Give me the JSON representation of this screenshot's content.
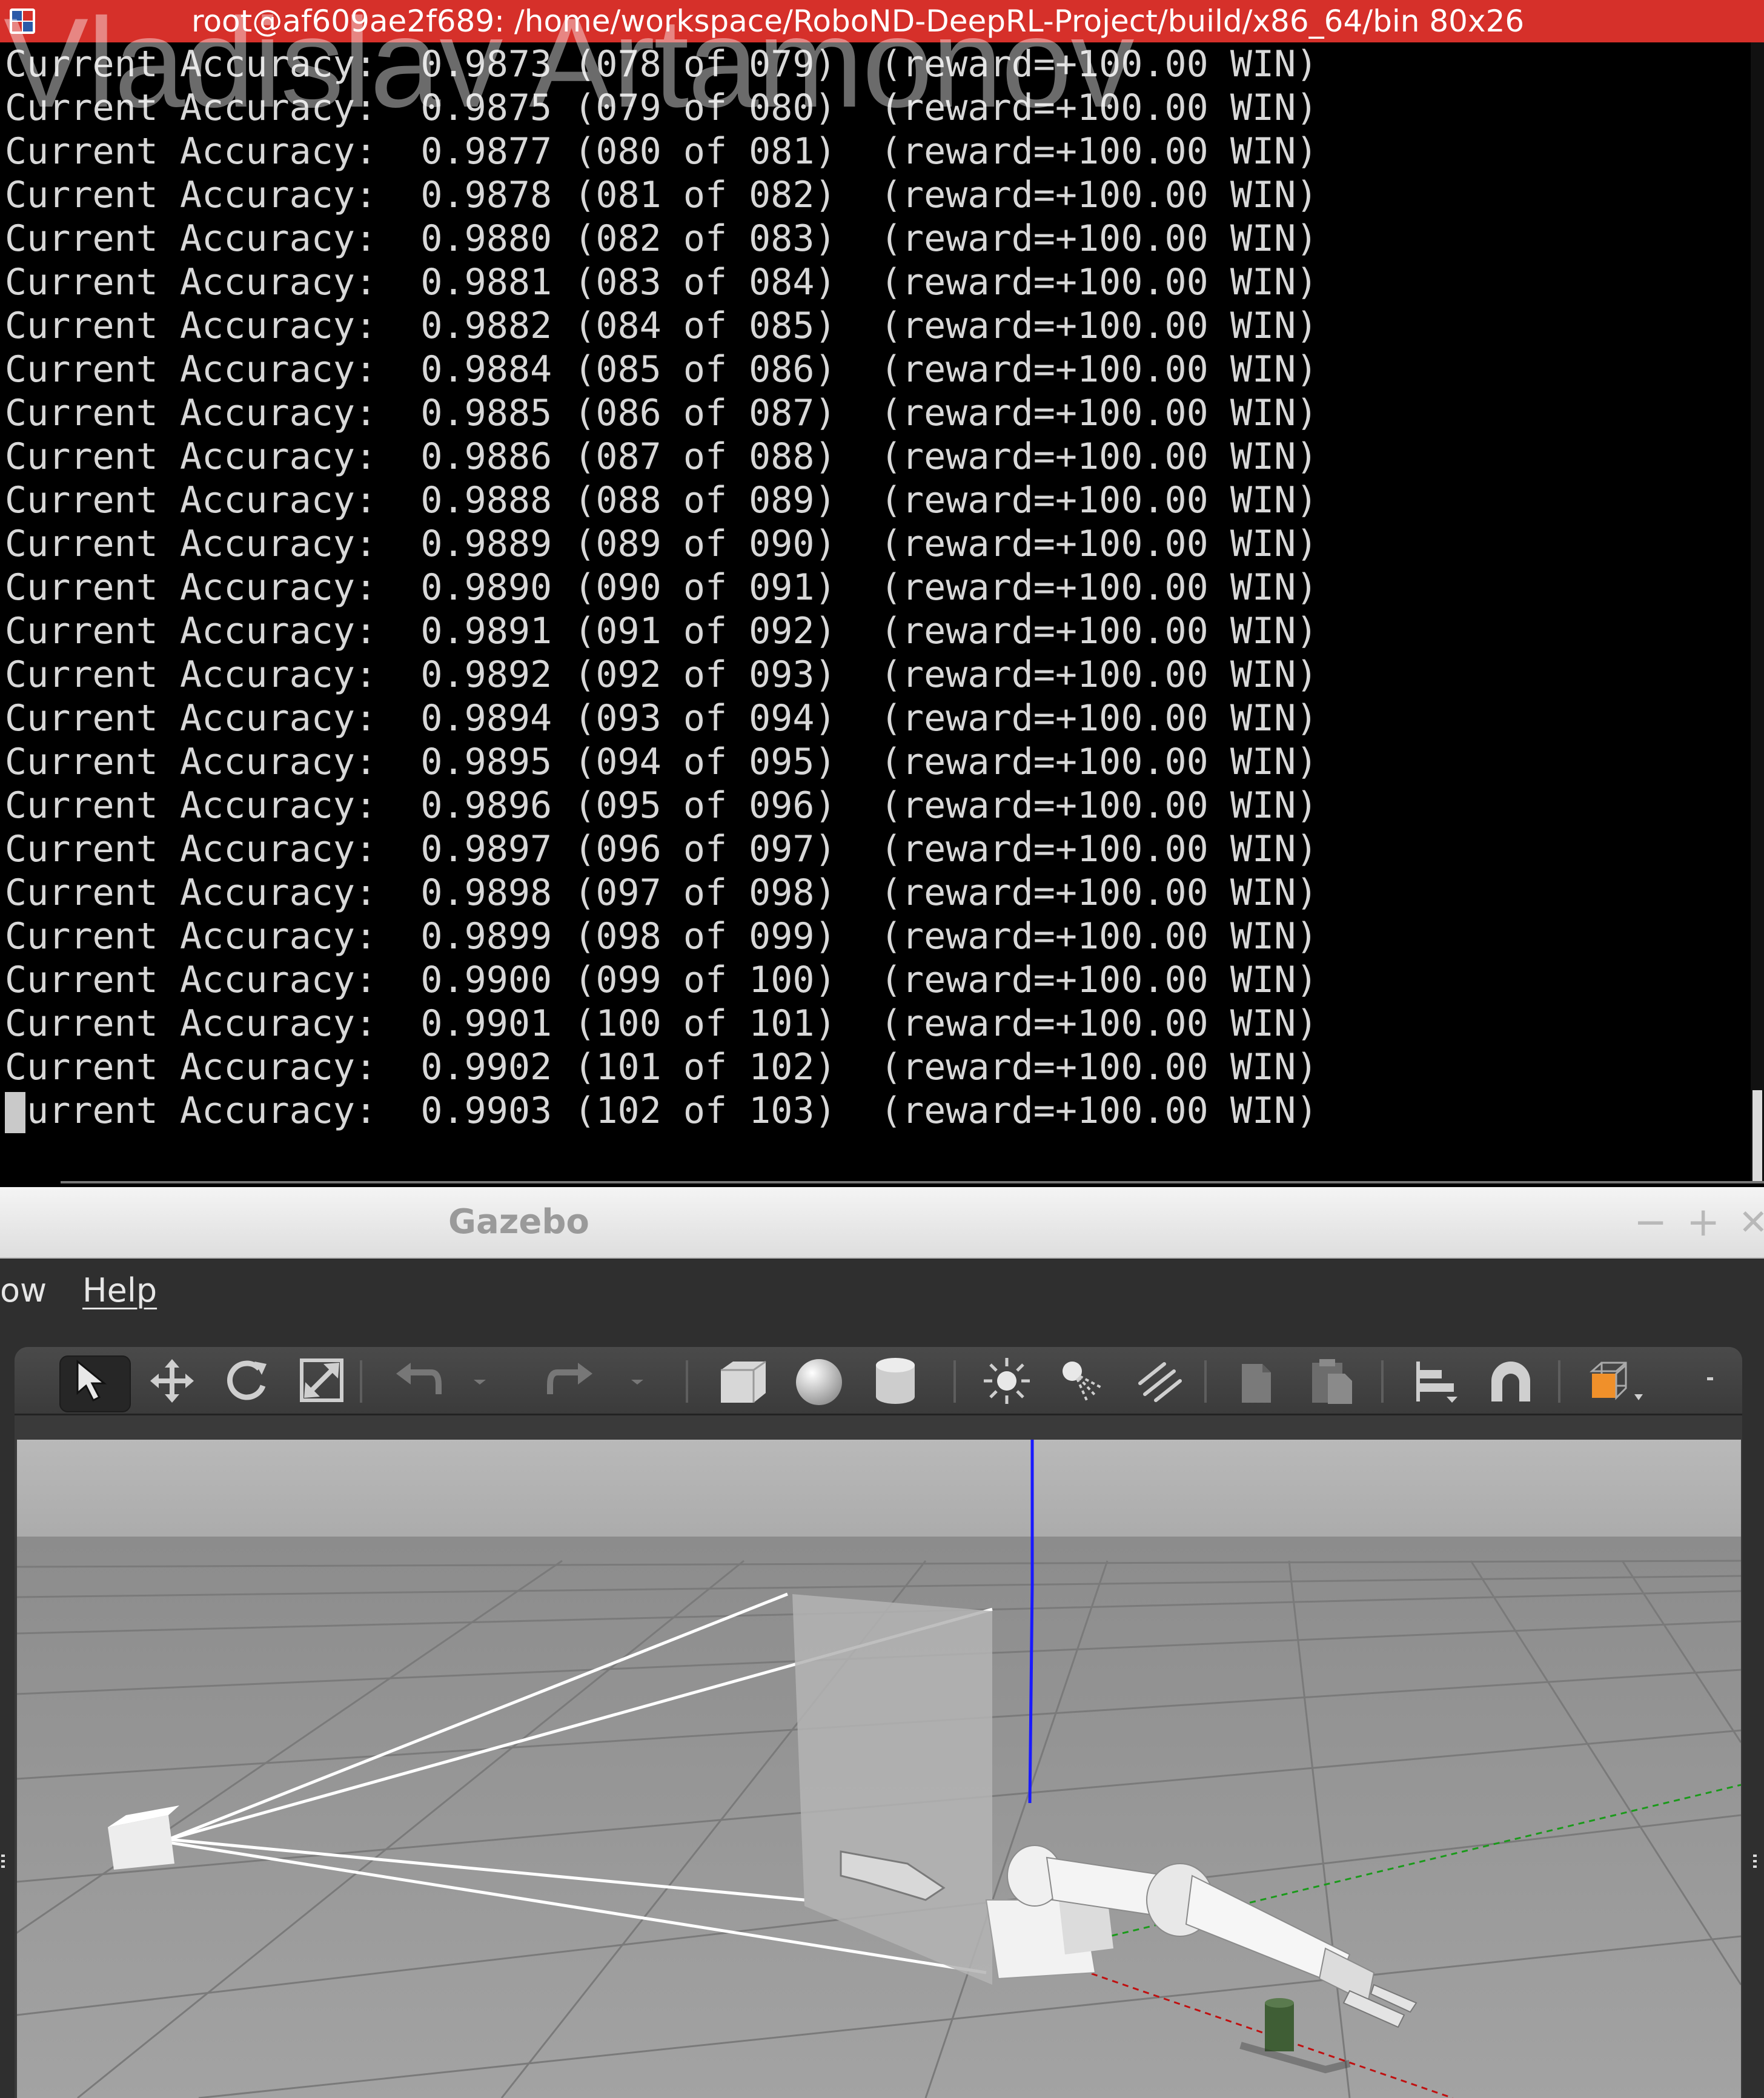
{
  "terminal": {
    "title": "root@af609ae2f689: /home/workspace/RoboND-DeepRL-Project/build/x86_64/bin 80x26",
    "watermark": "Vladislav Artamonov",
    "lines": [
      "Current Accuracy:  0.9873 (078 of 079)  (reward=+100.00 WIN)",
      "Current Accuracy:  0.9875 (079 of 080)  (reward=+100.00 WIN)",
      "Current Accuracy:  0.9877 (080 of 081)  (reward=+100.00 WIN)",
      "Current Accuracy:  0.9878 (081 of 082)  (reward=+100.00 WIN)",
      "Current Accuracy:  0.9880 (082 of 083)  (reward=+100.00 WIN)",
      "Current Accuracy:  0.9881 (083 of 084)  (reward=+100.00 WIN)",
      "Current Accuracy:  0.9882 (084 of 085)  (reward=+100.00 WIN)",
      "Current Accuracy:  0.9884 (085 of 086)  (reward=+100.00 WIN)",
      "Current Accuracy:  0.9885 (086 of 087)  (reward=+100.00 WIN)",
      "Current Accuracy:  0.9886 (087 of 088)  (reward=+100.00 WIN)",
      "Current Accuracy:  0.9888 (088 of 089)  (reward=+100.00 WIN)",
      "Current Accuracy:  0.9889 (089 of 090)  (reward=+100.00 WIN)",
      "Current Accuracy:  0.9890 (090 of 091)  (reward=+100.00 WIN)",
      "Current Accuracy:  0.9891 (091 of 092)  (reward=+100.00 WIN)",
      "Current Accuracy:  0.9892 (092 of 093)  (reward=+100.00 WIN)",
      "Current Accuracy:  0.9894 (093 of 094)  (reward=+100.00 WIN)",
      "Current Accuracy:  0.9895 (094 of 095)  (reward=+100.00 WIN)",
      "Current Accuracy:  0.9896 (095 of 096)  (reward=+100.00 WIN)",
      "Current Accuracy:  0.9897 (096 of 097)  (reward=+100.00 WIN)",
      "Current Accuracy:  0.9898 (097 of 098)  (reward=+100.00 WIN)",
      "Current Accuracy:  0.9899 (098 of 099)  (reward=+100.00 WIN)",
      "Current Accuracy:  0.9900 (099 of 100)  (reward=+100.00 WIN)",
      "Current Accuracy:  0.9901 (100 of 101)  (reward=+100.00 WIN)",
      "Current Accuracy:  0.9902 (101 of 102)  (reward=+100.00 WIN)",
      "Current Accuracy:  0.9903 (102 of 103)  (reward=+100.00 WIN)"
    ],
    "colors": {
      "titlebar": "#d6302a",
      "background": "#000000",
      "text": "#d8d8d8"
    }
  },
  "gazebo": {
    "title": "Gazebo",
    "window_controls": {
      "minimize": "−",
      "maximize": "+",
      "close": "✕"
    },
    "menu": {
      "window_partial": "ow",
      "help": "Help"
    },
    "toolbar": [
      {
        "name": "select-mode",
        "icon": "arrow-pointer-icon"
      },
      {
        "name": "translate-mode",
        "icon": "move-arrows-icon"
      },
      {
        "name": "rotate-mode",
        "icon": "rotate-icon"
      },
      {
        "name": "scale-mode",
        "icon": "scale-icon"
      },
      {
        "name": "undo",
        "icon": "undo-icon"
      },
      {
        "name": "undo-history",
        "icon": "dropdown-icon"
      },
      {
        "name": "redo",
        "icon": "redo-icon"
      },
      {
        "name": "redo-history",
        "icon": "dropdown-icon"
      },
      {
        "name": "box",
        "icon": "box-icon"
      },
      {
        "name": "sphere",
        "icon": "sphere-icon"
      },
      {
        "name": "cylinder",
        "icon": "cylinder-icon"
      },
      {
        "name": "point-light",
        "icon": "point-light-icon"
      },
      {
        "name": "spot-light",
        "icon": "spot-light-icon"
      },
      {
        "name": "directional-light",
        "icon": "directional-light-icon"
      },
      {
        "name": "copy",
        "icon": "copy-icon"
      },
      {
        "name": "paste",
        "icon": "paste-icon"
      },
      {
        "name": "align",
        "icon": "align-icon"
      },
      {
        "name": "snap",
        "icon": "magnet-icon"
      },
      {
        "name": "view-angle",
        "icon": "view-cube-icon"
      },
      {
        "name": "more",
        "icon": "more-icon"
      }
    ],
    "colors": {
      "accent": "#f0902a",
      "z_axis": "#1a1aff",
      "x_axis": "#c01010",
      "y_axis": "#1a9a1a"
    }
  }
}
